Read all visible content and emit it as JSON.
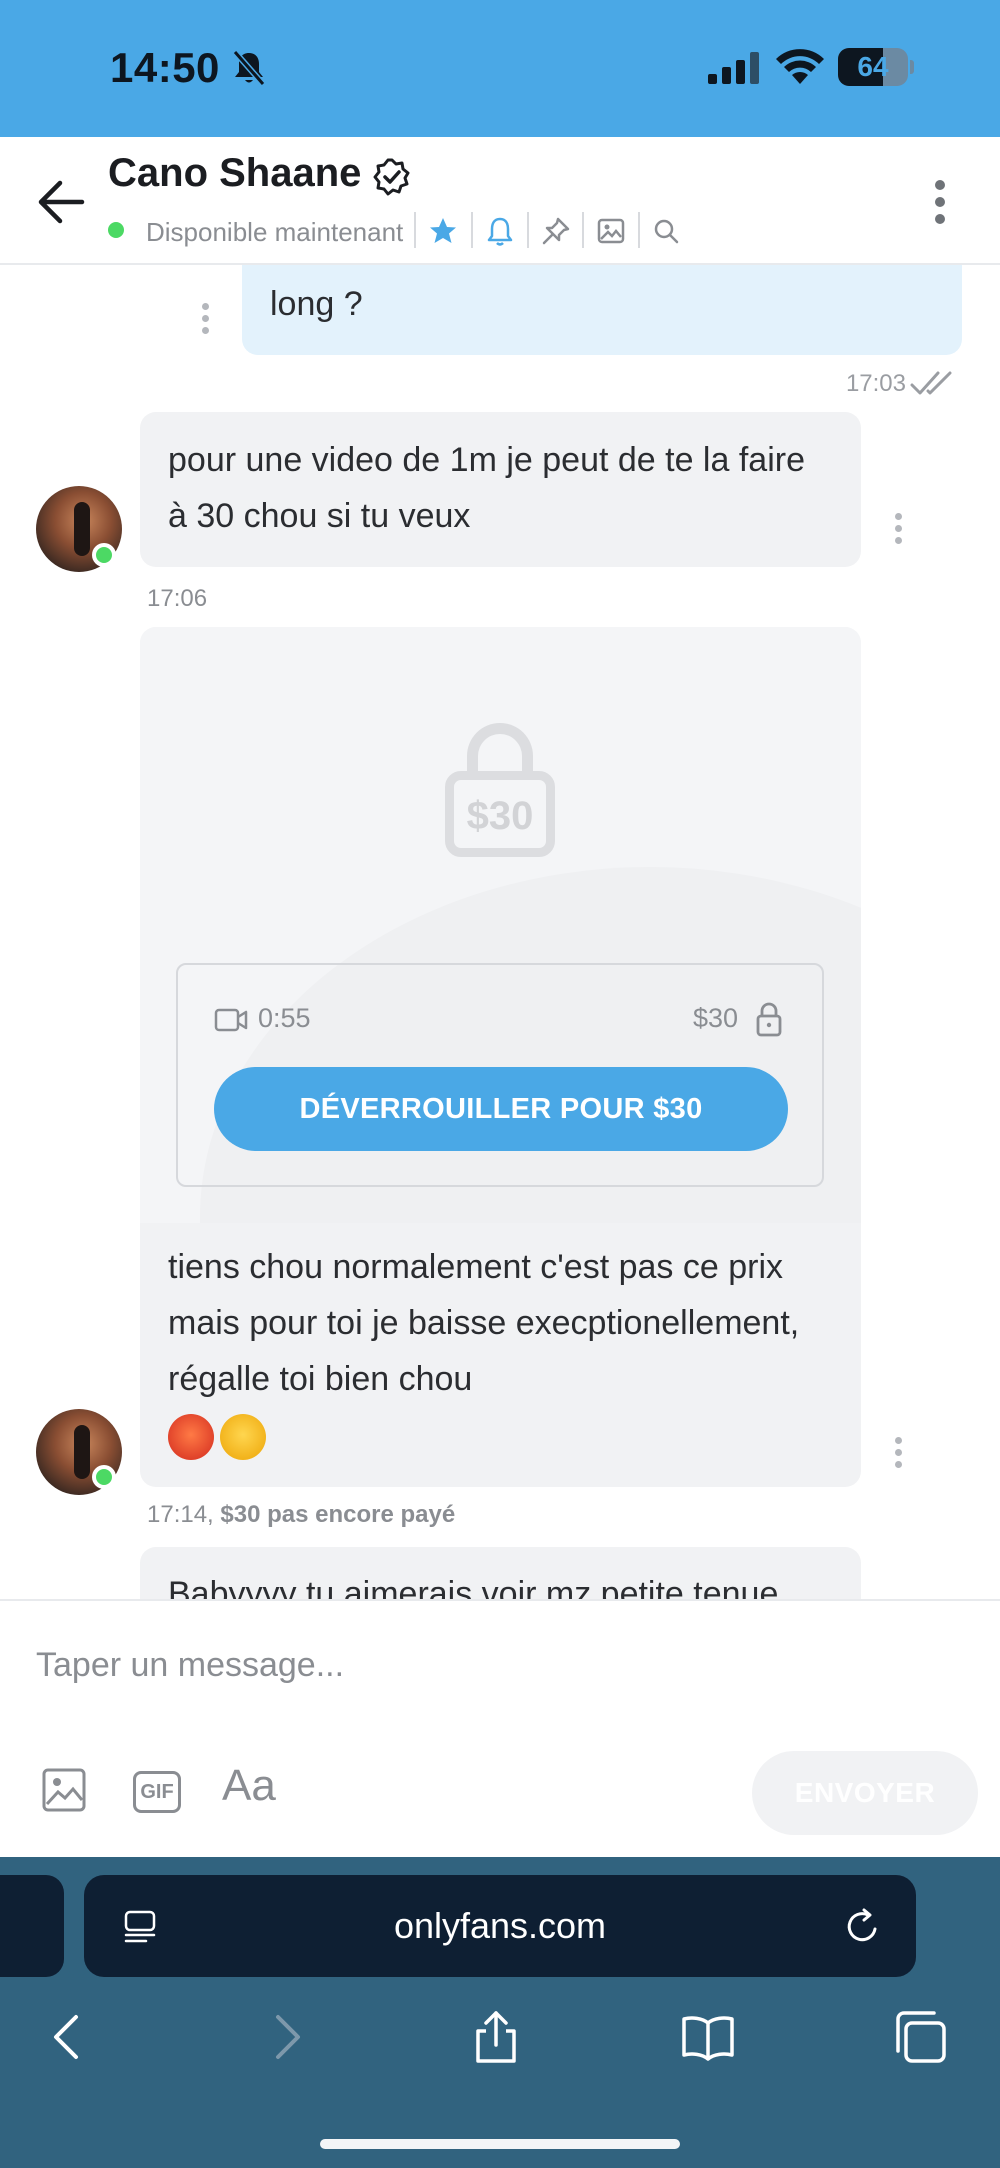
{
  "status_bar": {
    "time": "14:50",
    "battery": "64",
    "battery_level": 0.64
  },
  "header": {
    "name": "Cano Shaane",
    "status": "Disponible maintenant",
    "icons": [
      "back-arrow-icon",
      "verified-icon",
      "star-icon",
      "bell-icon",
      "pin-icon",
      "gallery-icon",
      "search-icon",
      "more-vertical-icon"
    ]
  },
  "messages": {
    "outgoing_partial": {
      "text": "long ?",
      "time": "17:03"
    },
    "incoming_1": {
      "text": "pour une video de 1m je peut de te la faire à 30 chou si tu veux",
      "time": "17:06"
    },
    "ppv": {
      "lock_price": "$30",
      "duration": "0:55",
      "price": "$30",
      "unlock_label": "DÉVERROUILLER POUR $30",
      "caption": "tiens chou normalement c'est pas ce prix mais pour toi je baisse execptionellement, régalle toi bien chou",
      "emojis": [
        "hot-face-emoji",
        "face-with-open-eyes-and-hand-over-mouth-emoji"
      ],
      "time": "17:14,",
      "paid_status": "$30 pas encore payé"
    },
    "incoming_partial": {
      "text": "Babyyyy tu aimerais voir mz petite tenue"
    }
  },
  "composer": {
    "placeholder": "Taper un message...",
    "text_format_label": "Aa",
    "gif_label": "GIF",
    "send_label": "ENVOYER"
  },
  "browser": {
    "url": "onlyfans.com",
    "nav": [
      "back-icon",
      "forward-icon",
      "share-icon",
      "bookmarks-icon",
      "tabs-icon"
    ]
  },
  "colors": {
    "brand_blue": "#4aa8e6",
    "incoming_bubble": "#f1f2f4",
    "outgoing_bubble": "#e3f2fc",
    "online_green": "#4cd964",
    "browser_bar": "#31637f"
  }
}
